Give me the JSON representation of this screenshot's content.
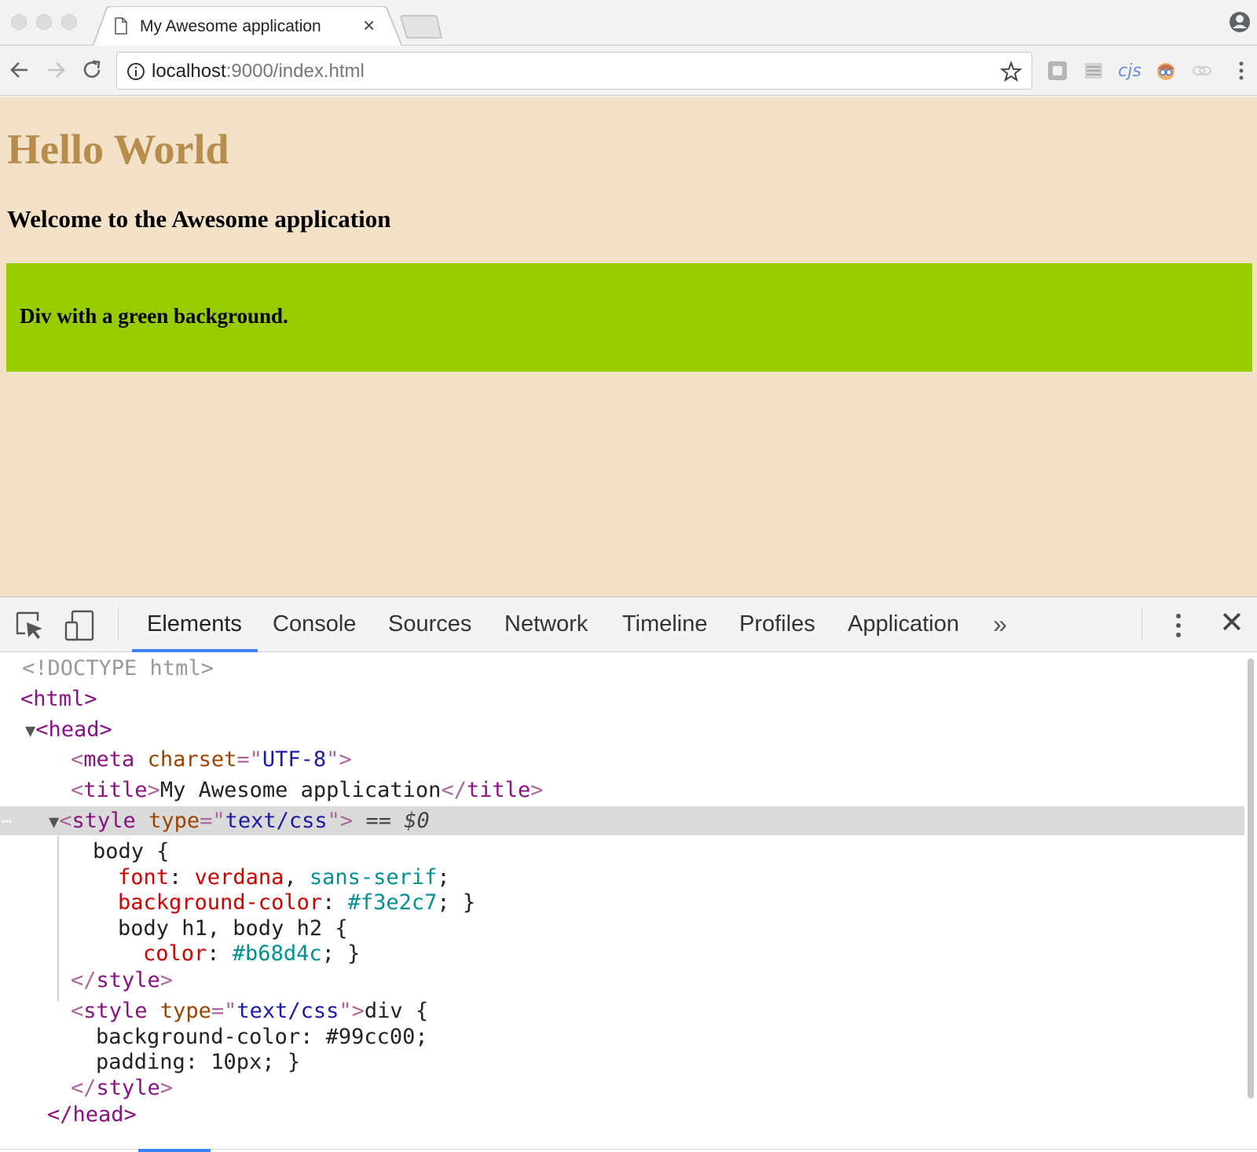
{
  "browser": {
    "tab_title": "My Awesome application",
    "tab_close": "×",
    "url_host": "localhost",
    "url_path": ":9000/index.html",
    "extension_label": "cjs"
  },
  "page": {
    "heading": "Hello World",
    "subheading": "Welcome to the Awesome application",
    "div_text": "Div with a green background.",
    "background_color": "#f3e2c7",
    "heading_color": "#b68d4c",
    "div_color": "#99cc00"
  },
  "devtools": {
    "tabs": [
      "Elements",
      "Console",
      "Sources",
      "Network",
      "Timeline",
      "Profiles",
      "Application"
    ],
    "active_tab": "Elements",
    "overflow": "»",
    "close": "✕",
    "dom": {
      "doctype": "<!DOCTYPE html>",
      "html_open": "<html>",
      "head_open": "<head>",
      "meta_tag": "meta",
      "meta_attr": "charset",
      "meta_val": "UTF-8",
      "title_tag": "title",
      "title_text": "My Awesome application",
      "style_tag": "style",
      "style_attr": "type",
      "style_val": "text/css",
      "selected_marker": "== $0",
      "css_lines": [
        "body {",
        "font: verdana, sans-serif;",
        "background-color: #f3e2c7; }",
        "body h1, body h2 {",
        "color: #b68d4c; }"
      ],
      "style2_text": "div {",
      "style2_lines": [
        "background-color: #99cc00;",
        "padding: 10px; }"
      ],
      "head_close": "</head>"
    }
  }
}
